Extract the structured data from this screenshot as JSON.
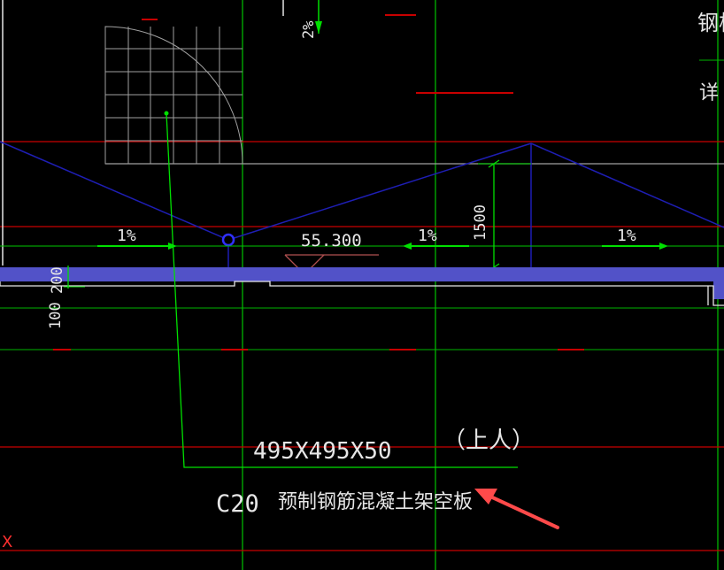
{
  "drawing": {
    "top_label_cut": "钢板",
    "detail_label_cut": "详",
    "top_vertical_slope": "2%",
    "slope_labels": [
      "1%",
      "1%",
      "1%"
    ],
    "elevation": "55.300",
    "dim_height": "1500",
    "dim_slab": "200",
    "dim_lower": "100",
    "panel_size": "495X495X50",
    "panel_note": "（上人）",
    "concrete_grade": "C20",
    "panel_desc": "预制钢筋混凝土架空板",
    "axis_label": "X"
  },
  "colors": {
    "background": "#000000",
    "axis_grid": "#00c800",
    "red_line": "#d00000",
    "blue_line": "#1e1eb4",
    "slab": "#5050c8",
    "white": "#e6e6e6",
    "gray": "#a0a0a0",
    "leader": "#00e000",
    "arrow": "#ff4040"
  }
}
